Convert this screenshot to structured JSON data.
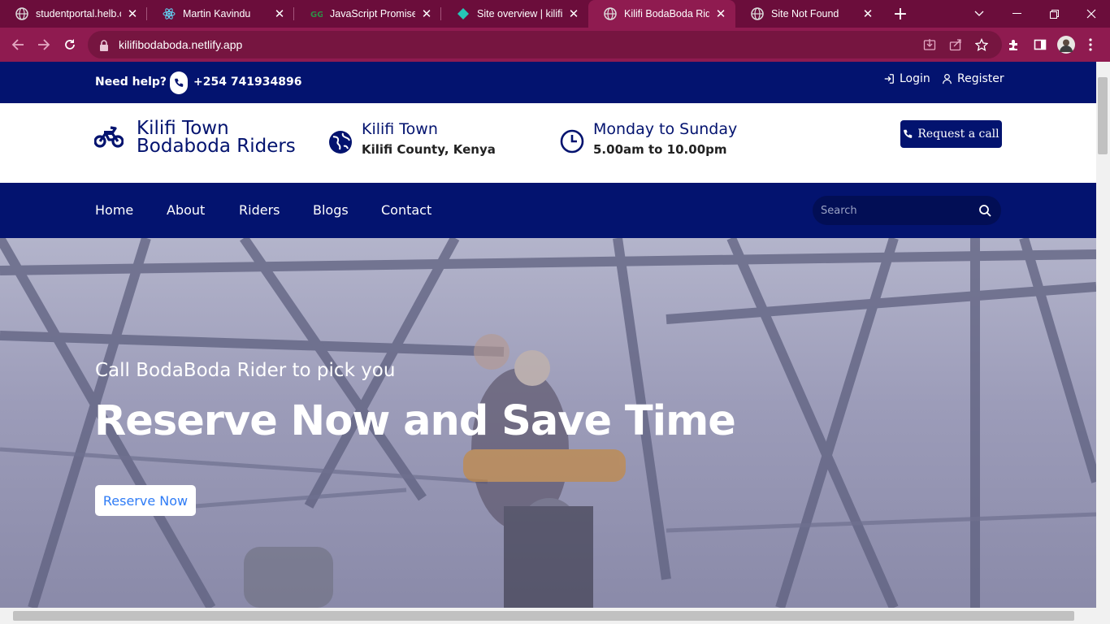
{
  "browser": {
    "tabs": [
      {
        "title": "studentportal.helb.co.ke",
        "icon": "globe-icon"
      },
      {
        "title": "Martin Kavindu",
        "icon": "react-icon"
      },
      {
        "title": "JavaScript Promise - G",
        "icon": "geeks-icon"
      },
      {
        "title": "Site overview | kilifibo",
        "icon": "netlify-icon"
      },
      {
        "title": "Kilifi BodaBoda Riders",
        "icon": "globe-icon"
      },
      {
        "title": "Site Not Found",
        "icon": "globe-icon"
      }
    ],
    "active_tab": 4,
    "url": "kilifibodaboda.netlify.app",
    "accent": "#8f1b50"
  },
  "topbar": {
    "help_label": "Need help?",
    "phone": "+254 741934896",
    "login_label": "Login",
    "register_label": "Register"
  },
  "header": {
    "brand_line1": "Kilifi Town",
    "brand_line2": "Bodaboda Riders",
    "location_title": "Kilifi Town",
    "location_sub": "Kilifi County, Kenya",
    "hours_title": "Monday to Sunday",
    "hours_sub": "5.00am to 10.00pm",
    "request_label": "Request a call"
  },
  "nav": {
    "links": [
      "Home",
      "About",
      "Riders",
      "Blogs",
      "Contact"
    ],
    "search_placeholder": "Search"
  },
  "hero": {
    "subtitle": "Call BodaBoda Rider to pick you",
    "title": "Reserve Now and Save Time",
    "cta_label": "Reserve Now"
  },
  "colors": {
    "primary": "#03136f",
    "cta_text": "#2f7cf6"
  }
}
